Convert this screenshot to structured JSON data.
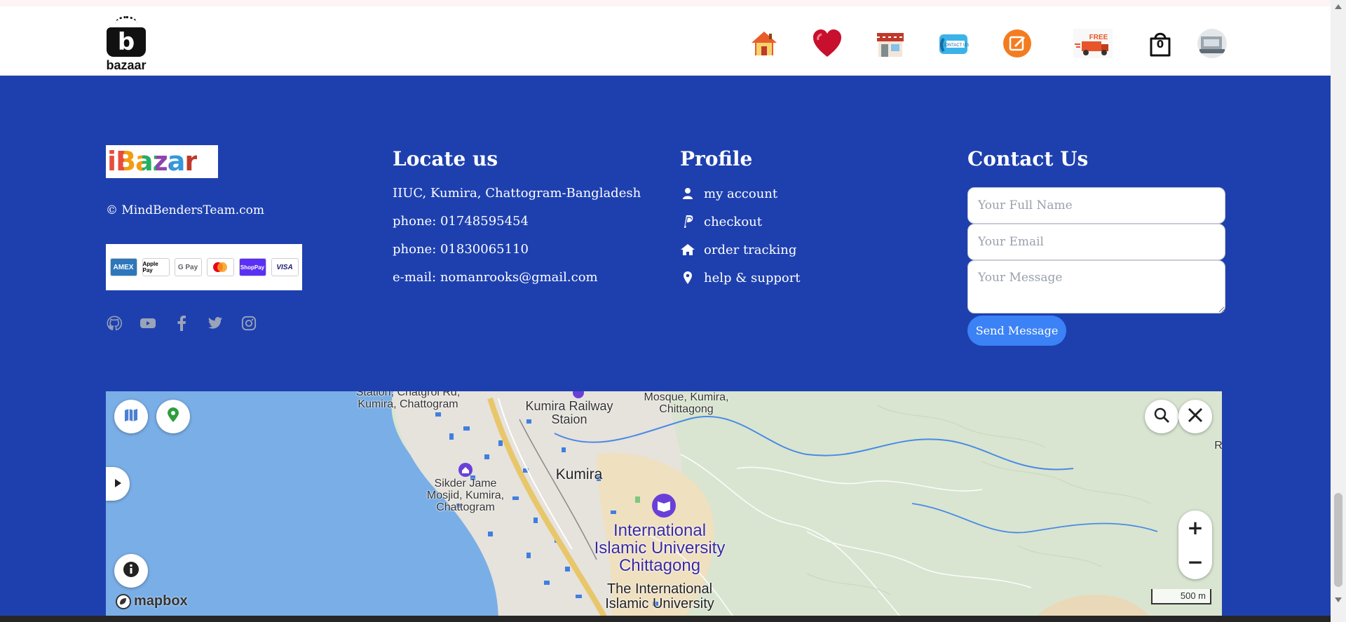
{
  "brand": {
    "logo_text": "bazaar",
    "logo_letter": "b"
  },
  "nav": {
    "icons": [
      "home-icon",
      "heart-icon",
      "store-icon",
      "contact-icon",
      "blog-icon",
      "free-delivery-icon",
      "cart-icon",
      "user-avatar-icon"
    ],
    "cart_count": "0",
    "free_delivery_label": "FREE"
  },
  "footer": {
    "ibazar_logo": "iBazar",
    "copyright": "© MindBendersTeam.com",
    "payments": [
      "AMEX",
      "Apple Pay",
      "G Pay",
      "Mastercard",
      "ShopPay",
      "VISA"
    ],
    "socials": [
      "github-icon",
      "youtube-icon",
      "facebook-icon",
      "twitter-icon",
      "instagram-icon"
    ],
    "locate": {
      "title": "Locate us",
      "address": "IIUC, Kumira, Chattogram-Bangladesh",
      "phone1": "phone: 01748595454",
      "phone2": "phone: 01830065110",
      "email": "e-mail: nomanrooks@gmail.com"
    },
    "profile": {
      "title": "Profile",
      "items": [
        {
          "label": "my account",
          "icon": "user-icon"
        },
        {
          "label": "checkout",
          "icon": "paypal-icon"
        },
        {
          "label": "order tracking",
          "icon": "home-icon"
        },
        {
          "label": "help & support",
          "icon": "location-pin-icon"
        }
      ]
    },
    "contact": {
      "title": "Contact Us",
      "name_placeholder": "Your Full Name",
      "email_placeholder": "Your Email",
      "message_placeholder": "Your Message",
      "send_label": "Send Message"
    }
  },
  "map": {
    "labels": {
      "station_rd": "Station, Chatgrol Rd, Kumira, Chattogram",
      "railway": "Kumira Railway Staion",
      "mosque": "Mosque, Kumira, Chittagong",
      "kumira": "Kumira",
      "sikder": "Sikder Jame Mosjid, Kumira, Chattogram",
      "iiuc": "International Islamic University Chittagong",
      "iiuc2": "The International Islamic University",
      "edge_r": "R"
    },
    "attribution": "mapbox",
    "scale": "500 m",
    "colors": {
      "water": "#7aaee6",
      "land": "#e6e2dc",
      "park": "#d9e5d0",
      "road": "#e8c66a",
      "poi": "#6a3fd8"
    }
  }
}
